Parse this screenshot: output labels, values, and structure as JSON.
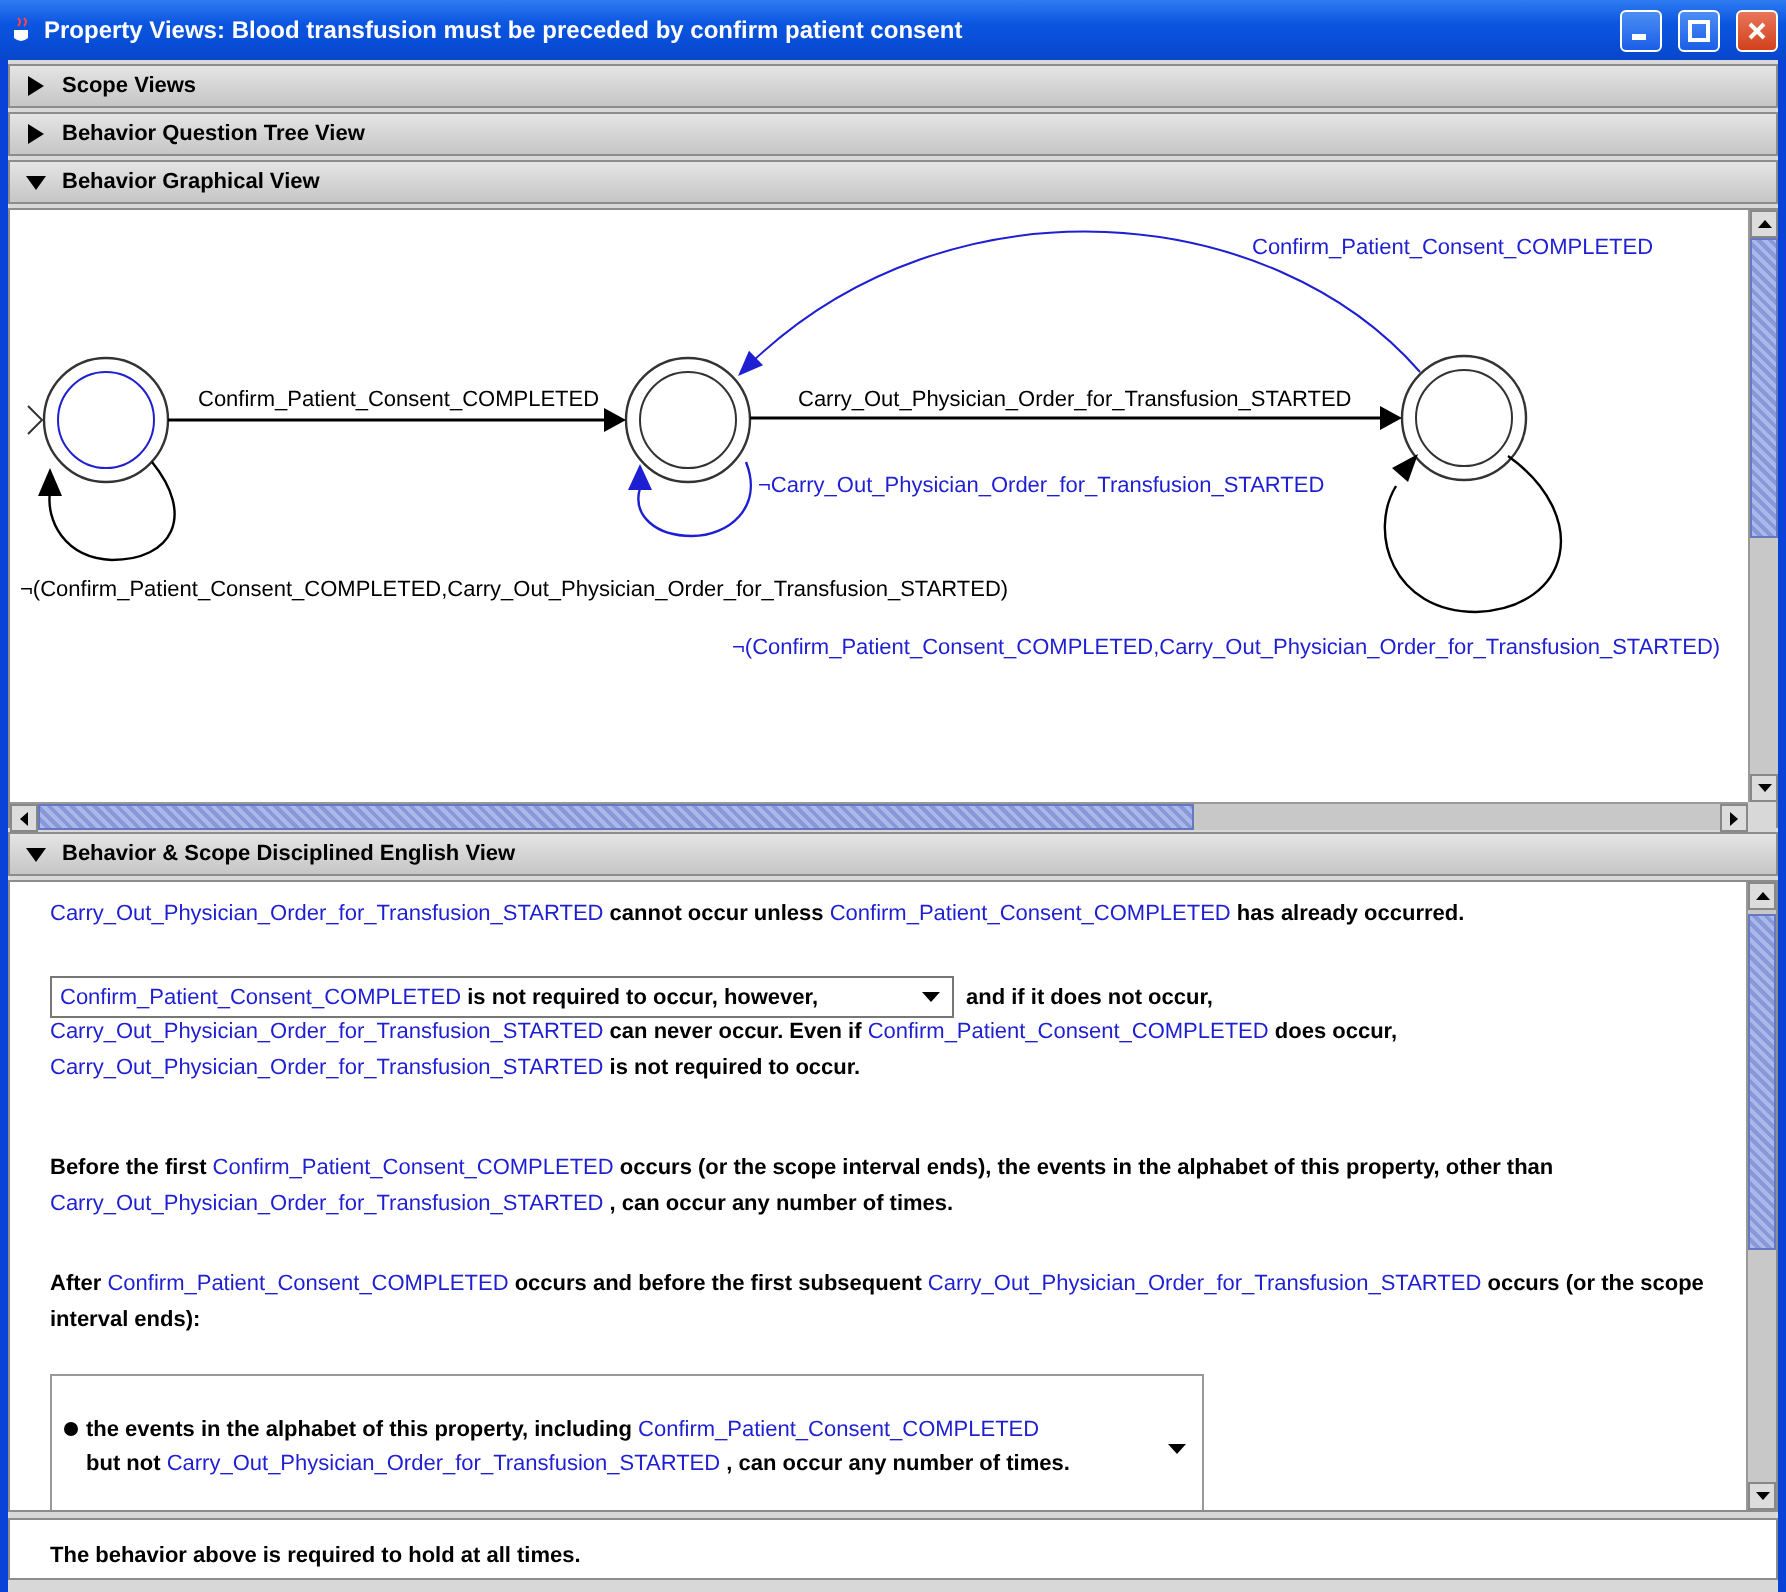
{
  "window": {
    "title": "Property Views: Blood transfusion must be preceded by confirm patient consent"
  },
  "sections": [
    {
      "title": "Scope Views",
      "expanded": false
    },
    {
      "title": "Behavior Question Tree View",
      "expanded": false
    },
    {
      "title": "Behavior Graphical View",
      "expanded": true,
      "kind": "graph"
    },
    {
      "title": "Behavior & Scope Disciplined English View",
      "expanded": true,
      "kind": "english"
    }
  ],
  "graph": {
    "states": [
      {
        "initial": true
      },
      {
        "initial": false
      },
      {
        "initial": false
      }
    ],
    "transitions": [
      {
        "kind": "straight",
        "label": "Confirm_Patient_Consent_COMPLETED",
        "color": "#000000"
      },
      {
        "kind": "loop",
        "label": "¬(Confirm_Patient_Consent_COMPLETED,Carry_Out_Physician_Order_for_Transfusion_STARTED)",
        "color": "#000000"
      },
      {
        "kind": "straight",
        "label": "Carry_Out_Physician_Order_for_Transfusion_STARTED",
        "color": "#000000"
      },
      {
        "kind": "loop",
        "label": "¬Carry_Out_Physician_Order_for_Transfusion_STARTED",
        "color": "#1e1ed2"
      },
      {
        "kind": "arc",
        "label": "Confirm_Patient_Consent_COMPLETED",
        "color": "#1e1ed2"
      },
      {
        "kind": "loop",
        "label": "¬(Confirm_Patient_Consent_COMPLETED,Carry_Out_Physician_Order_for_Transfusion_STARTED)",
        "color": "#1e1ed2"
      }
    ]
  },
  "english": {
    "paragraphs": [
      {
        "kind": "sentence",
        "segments": [
          {
            "kind": "event",
            "text": "Carry_Out_Physician_Order_for_Transfusion_STARTED"
          },
          {
            "kind": "plain",
            "text": " cannot occur unless "
          },
          {
            "kind": "event",
            "text": "Confirm_Patient_Consent_COMPLETED"
          },
          {
            "kind": "plain",
            "text": " has already occurred."
          }
        ]
      },
      {
        "kind": "choice",
        "choice": [
          {
            "kind": "event",
            "text": "Confirm_Patient_Consent_COMPLETED"
          },
          {
            "kind": "plain",
            "text": " is not required to occur, however,"
          }
        ],
        "after": [
          {
            "kind": "plain",
            "text": "and if it does not occur,"
          }
        ],
        "segments": [
          {
            "kind": "event",
            "text": "Carry_Out_Physician_Order_for_Transfusion_STARTED"
          },
          {
            "kind": "plain",
            "text": " can never occur. Even if "
          },
          {
            "kind": "event",
            "text": "Confirm_Patient_Consent_COMPLETED"
          },
          {
            "kind": "plain",
            "text": " does occur, "
          },
          {
            "kind": "event",
            "text": "Carry_Out_Physician_Order_for_Transfusion_STARTED"
          },
          {
            "kind": "plain",
            "text": " is not required to occur."
          }
        ]
      },
      {
        "kind": "sentence",
        "segments": [
          {
            "kind": "plain",
            "text": "Before the first "
          },
          {
            "kind": "event",
            "text": "Confirm_Patient_Consent_COMPLETED"
          },
          {
            "kind": "plain",
            "text": " occurs (or the scope interval ends), the events in the alphabet of this property, other than "
          },
          {
            "kind": "event",
            "text": "Carry_Out_Physician_Order_for_Transfusion_STARTED"
          },
          {
            "kind": "plain",
            "text": " , can occur any number of times."
          }
        ]
      },
      {
        "kind": "sentence",
        "segments": [
          {
            "kind": "plain",
            "text": "After "
          },
          {
            "kind": "event",
            "text": "Confirm_Patient_Consent_COMPLETED"
          },
          {
            "kind": "plain",
            "text": " occurs and before the first subsequent "
          },
          {
            "kind": "event",
            "text": "Carry_Out_Physician_Order_for_Transfusion_STARTED"
          },
          {
            "kind": "plain",
            "text": " occurs (or the scope interval ends):"
          }
        ]
      },
      {
        "kind": "bullet_choice",
        "lines": [
          [
            {
              "kind": "plain",
              "text": "the events in the alphabet of this property, including "
            },
            {
              "kind": "event",
              "text": "Confirm_Patient_Consent_COMPLETED"
            }
          ],
          [
            {
              "kind": "plain",
              "text": "but not "
            },
            {
              "kind": "event",
              "text": "Carry_Out_Physician_Order_for_Transfusion_STARTED"
            },
            {
              "kind": "plain",
              "text": " , can occur any number of times."
            }
          ]
        ]
      }
    ]
  },
  "footer": {
    "text": "The behavior above is required to hold at all times."
  }
}
